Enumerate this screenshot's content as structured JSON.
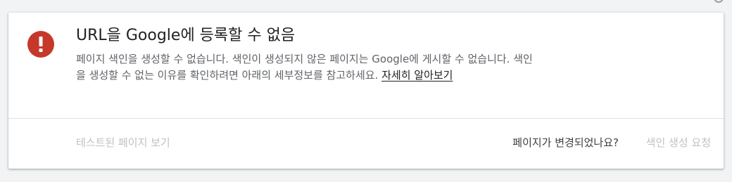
{
  "colors": {
    "error_icon_bg": "#c5392a",
    "page_bg": "#f1f3f4",
    "card_bg": "#ffffff",
    "disabled_text": "#bdc1c6",
    "secondary_text": "#5f6368",
    "primary_text": "#202124"
  },
  "status": {
    "icon": "error-exclamation-icon",
    "title": "URL을 Google에 등록할 수 없음",
    "description": "페이지 색인을 생성할 수 없습니다. 색인이 생성되지 않은 페이지는 Google에 게시할 수 없습니다. 색인을 생성할 수 없는 이유를 확인하려면 아래의 세부정보를 참고하세요.",
    "learn_more_label": "자세히 알아보기"
  },
  "footer": {
    "view_tested_page_label": "테스트된 페이지 보기",
    "page_changed_question": "페이지가 변경되었나요?",
    "request_indexing_label": "색인 생성 요청"
  }
}
